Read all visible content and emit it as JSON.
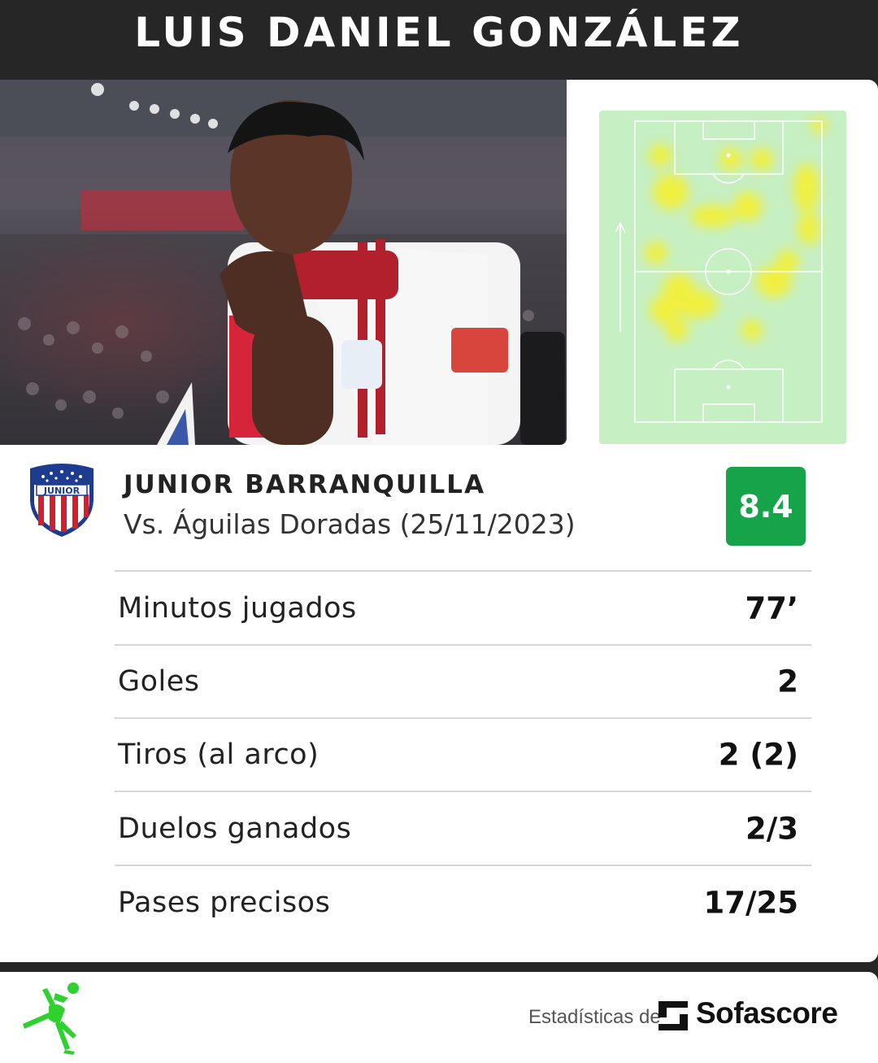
{
  "header": {
    "player_name": "LUIS DANIEL GONZÁLEZ"
  },
  "team": {
    "name": "JUNIOR BARRANQUILLA",
    "match": "Vs. Águilas Doradas (25/11/2023)",
    "logo_text": "JUNIOR",
    "rating": "8.4",
    "rating_color": "#16a34a"
  },
  "stats": [
    {
      "label": "Minutos jugados",
      "value": "77’"
    },
    {
      "label": "Goles",
      "value": "2"
    },
    {
      "label": "Tiros (al arco)",
      "value": "2 (2)"
    },
    {
      "label": "Duelos ganados",
      "value": "2/3"
    },
    {
      "label": "Pases precisos",
      "value": "17/25"
    }
  ],
  "footer": {
    "credit": "Estadísticas de",
    "brand": "Sofascore",
    "icon": "bicycle-kick-player-icon"
  },
  "colors": {
    "background_dark": "#262626",
    "pitch": "#c6efc3",
    "heat": "#f5f032"
  }
}
